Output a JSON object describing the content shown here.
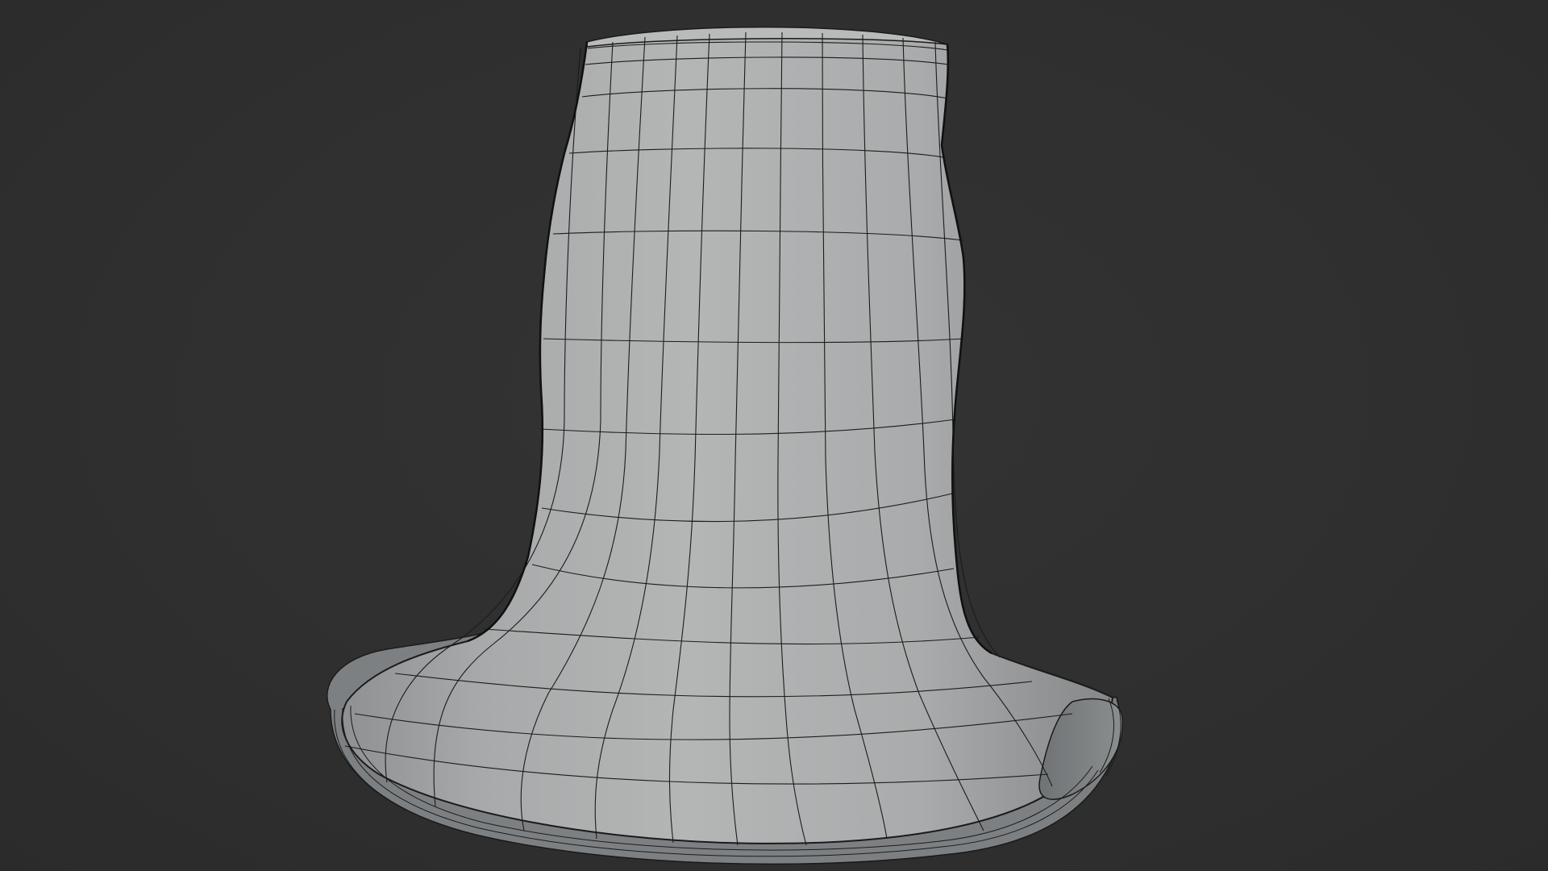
{
  "viewport": {
    "mode": "3d-viewport",
    "shading": "solid",
    "overlay": "wireframe",
    "background_color": "#303030",
    "mesh_color": "#9fa2a4",
    "wire_color": "#1a1a1a",
    "object": {
      "shape": "mesh-hat-like-sleeve",
      "description_hidden": ""
    }
  }
}
